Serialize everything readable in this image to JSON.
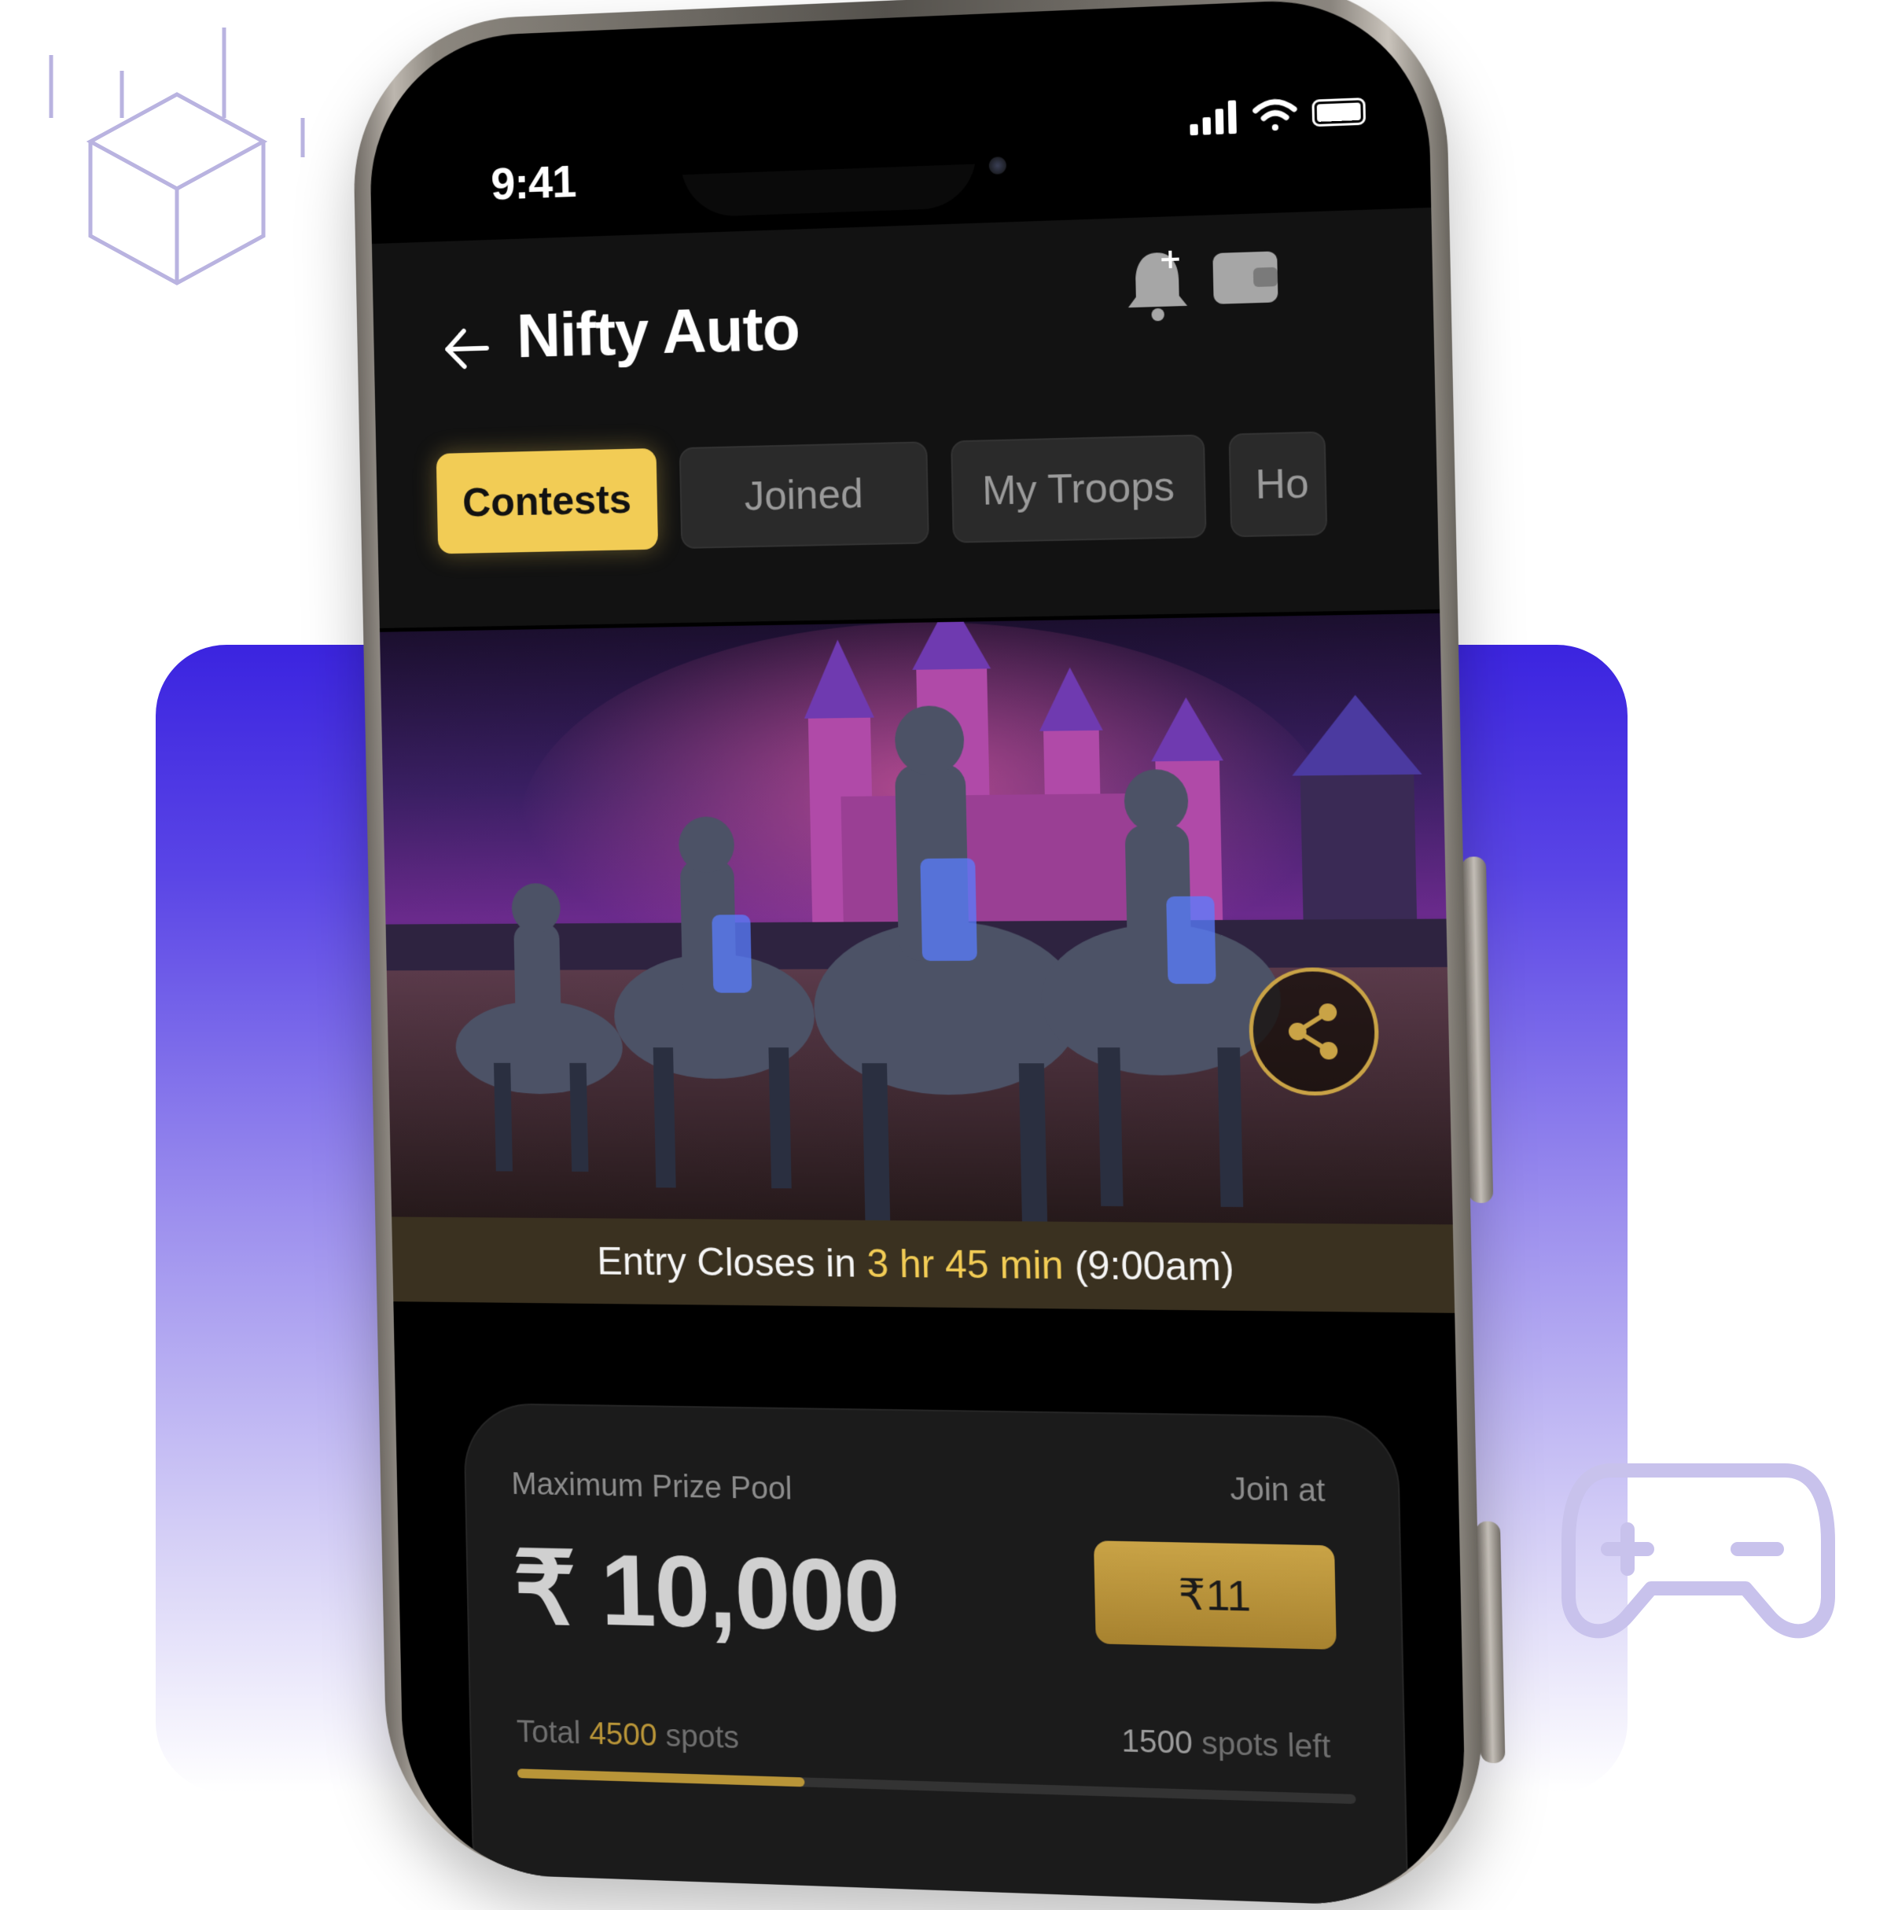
{
  "status_bar": {
    "time": "9:41"
  },
  "header": {
    "title": "Nifty Auto"
  },
  "tabs": [
    {
      "label": "Contests",
      "active": true
    },
    {
      "label": "Joined",
      "active": false
    },
    {
      "label": "My Troops",
      "active": false
    },
    {
      "label": "Ho",
      "active": false
    }
  ],
  "banner": {
    "entry_prefix": "Entry Closes in",
    "entry_countdown": "3 hr 45 min",
    "entry_time": "(9:00am)"
  },
  "contest_card": {
    "prize_label": "Maximum Prize Pool",
    "prize_value": "₹ 10,000",
    "join_label": "Join at",
    "join_price": "₹11",
    "total_prefix": "Total",
    "total_spots": "4500",
    "total_suffix": "spots",
    "spots_left_num": "1500",
    "spots_left_suffix": "spots left",
    "progress_fraction": 0.35
  },
  "colors": {
    "accent": "#f2cc55",
    "gold": "#b99538",
    "background_gradient_top": "#3b24e0"
  },
  "icons": [
    "back-arrow-icon",
    "bell-icon",
    "wallet-icon",
    "share-icon",
    "signal-icon",
    "wifi-icon",
    "battery-icon",
    "cube-icon",
    "gamepad-icon"
  ]
}
